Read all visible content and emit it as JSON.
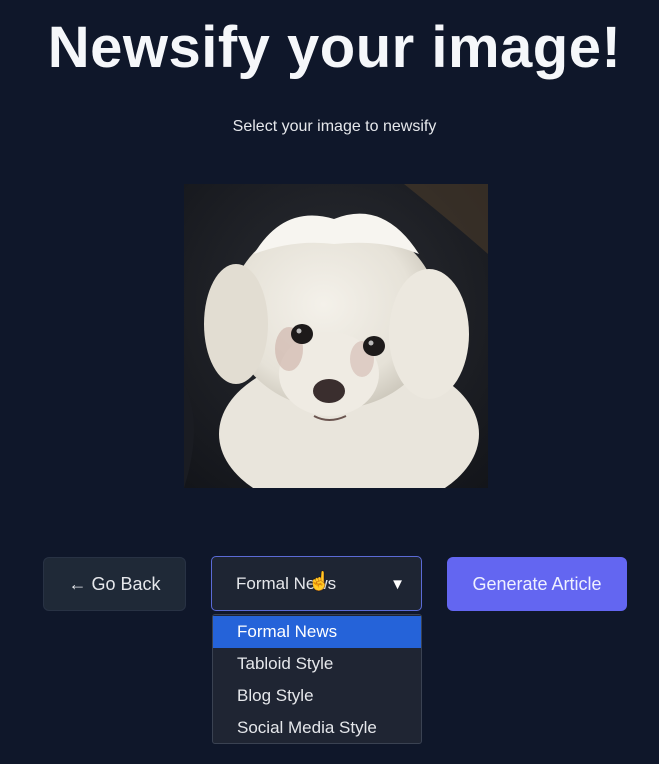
{
  "header": {
    "title": "Newsify your image!",
    "subtitle": "Select your image to newsify"
  },
  "image": {
    "subject": "dog-photo"
  },
  "controls": {
    "back_label": "← Go Back",
    "style_select": {
      "selected": "Formal News",
      "options": [
        "Formal News",
        "Tabloid Style",
        "Blog Style",
        "Social Media Style"
      ],
      "arrow_icon": "triangle-down-icon"
    },
    "generate_label": "Generate Article"
  },
  "colors": {
    "background": "#0f172a",
    "accent": "#6366f1",
    "selected_option": "#2563d9"
  }
}
